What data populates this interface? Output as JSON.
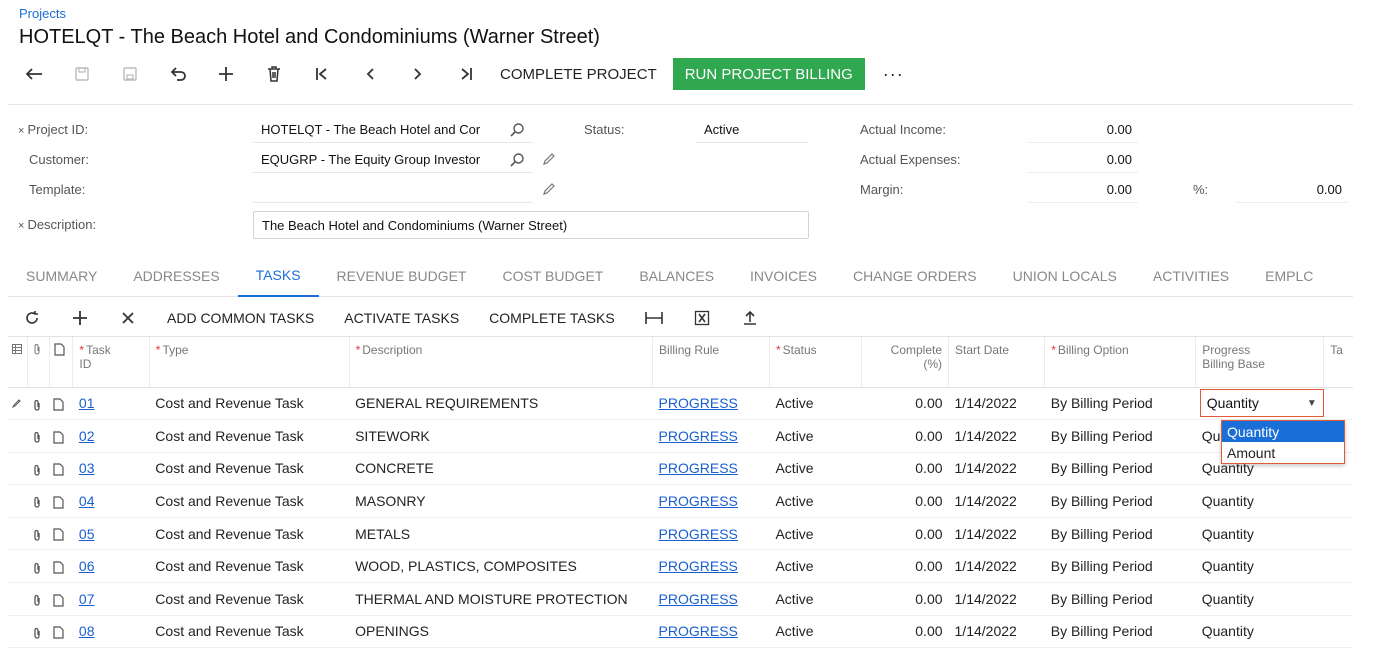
{
  "breadcrumb": "Projects",
  "title": "HOTELQT - The Beach Hotel and Condominiums (Warner Street)",
  "toolbar": {
    "complete_project": "COMPLETE PROJECT",
    "run_billing": "RUN PROJECT BILLING",
    "more": "···"
  },
  "form": {
    "project_id_label": "Project ID:",
    "project_id_value": "HOTELQT - The Beach Hotel and Cor",
    "customer_label": "Customer:",
    "customer_value": "EQUGRP - The Equity Group Investor",
    "template_label": "Template:",
    "template_value": "",
    "description_label": "Description:",
    "description_value": "The Beach Hotel and Condominiums (Warner Street)",
    "status_label": "Status:",
    "status_value": "Active",
    "actual_income_label": "Actual Income:",
    "actual_income_value": "0.00",
    "actual_expenses_label": "Actual Expenses:",
    "actual_expenses_value": "0.00",
    "margin_label": "Margin:",
    "margin_value": "0.00",
    "percent_label": "%:",
    "percent_value": "0.00",
    "required_mark": "×"
  },
  "tabs": [
    "SUMMARY",
    "ADDRESSES",
    "TASKS",
    "REVENUE BUDGET",
    "COST BUDGET",
    "BALANCES",
    "INVOICES",
    "CHANGE ORDERS",
    "UNION LOCALS",
    "ACTIVITIES",
    "EMPLC"
  ],
  "grid_toolbar": {
    "add_common": "ADD COMMON TASKS",
    "activate": "ACTIVATE TASKS",
    "complete": "COMPLETE TASKS"
  },
  "columns": {
    "task_id": [
      "Task",
      "ID"
    ],
    "type": "Type",
    "description": "Description",
    "billing_rule": "Billing Rule",
    "status": "Status",
    "complete": [
      "Complete",
      "(%)"
    ],
    "start_date": "Start Date",
    "billing_option": "Billing Option",
    "progress_base": [
      "Progress",
      "Billing Base"
    ],
    "tax": "Ta"
  },
  "rows": [
    {
      "id": "01",
      "type": "Cost and Revenue Task",
      "desc": "GENERAL REQUIREMENTS",
      "rule": "PROGRESS",
      "status": "Active",
      "complete": "0.00",
      "start": "1/14/2022",
      "option": "By Billing Period",
      "base": "Quantity"
    },
    {
      "id": "02",
      "type": "Cost and Revenue Task",
      "desc": "SITEWORK",
      "rule": "PROGRESS",
      "status": "Active",
      "complete": "0.00",
      "start": "1/14/2022",
      "option": "By Billing Period",
      "base": "Quantity"
    },
    {
      "id": "03",
      "type": "Cost and Revenue Task",
      "desc": "CONCRETE",
      "rule": "PROGRESS",
      "status": "Active",
      "complete": "0.00",
      "start": "1/14/2022",
      "option": "By Billing Period",
      "base": "Quantity"
    },
    {
      "id": "04",
      "type": "Cost and Revenue Task",
      "desc": "MASONRY",
      "rule": "PROGRESS",
      "status": "Active",
      "complete": "0.00",
      "start": "1/14/2022",
      "option": "By Billing Period",
      "base": "Quantity"
    },
    {
      "id": "05",
      "type": "Cost and Revenue Task",
      "desc": "METALS",
      "rule": "PROGRESS",
      "status": "Active",
      "complete": "0.00",
      "start": "1/14/2022",
      "option": "By Billing Period",
      "base": "Quantity"
    },
    {
      "id": "06",
      "type": "Cost and Revenue Task",
      "desc": "WOOD, PLASTICS, COMPOSITES",
      "rule": "PROGRESS",
      "status": "Active",
      "complete": "0.00",
      "start": "1/14/2022",
      "option": "By Billing Period",
      "base": "Quantity"
    },
    {
      "id": "07",
      "type": "Cost and Revenue Task",
      "desc": "THERMAL AND MOISTURE PROTECTION",
      "rule": "PROGRESS",
      "status": "Active",
      "complete": "0.00",
      "start": "1/14/2022",
      "option": "By Billing Period",
      "base": "Quantity"
    },
    {
      "id": "08",
      "type": "Cost and Revenue Task",
      "desc": "OPENINGS",
      "rule": "PROGRESS",
      "status": "Active",
      "complete": "0.00",
      "start": "1/14/2022",
      "option": "By Billing Period",
      "base": "Quantity"
    }
  ],
  "dropdown": {
    "selected": "Quantity",
    "options": [
      "Quantity",
      "Amount"
    ]
  }
}
